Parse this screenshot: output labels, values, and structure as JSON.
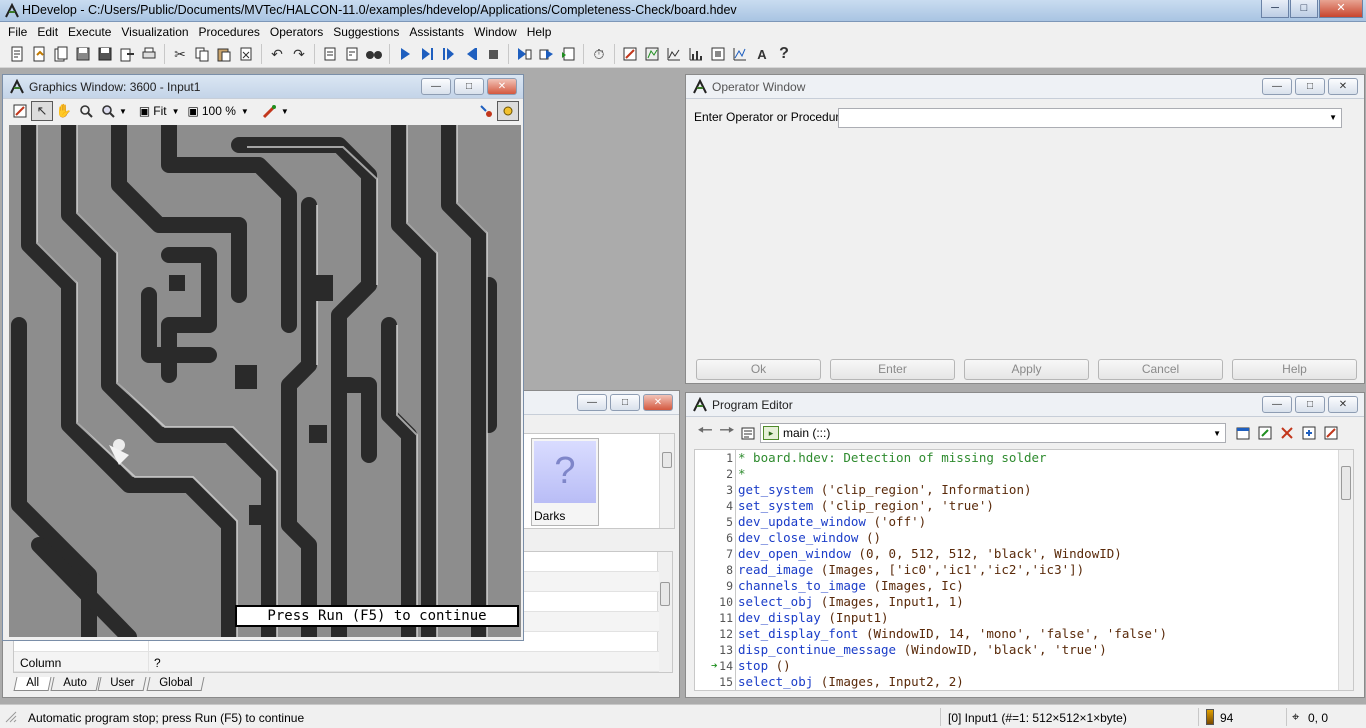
{
  "app": {
    "title": "HDevelop - C:/Users/Public/Documents/MVTec/HALCON-11.0/examples/hdevelop/Applications/Completeness-Check/board.hdev"
  },
  "menu": {
    "items": [
      {
        "label": "File",
        "key": "F"
      },
      {
        "label": "Edit",
        "key": "E"
      },
      {
        "label": "Execute",
        "key": "x"
      },
      {
        "label": "Visualization",
        "key": "V"
      },
      {
        "label": "Procedures",
        "key": "P"
      },
      {
        "label": "Operators",
        "key": "O"
      },
      {
        "label": "Suggestions",
        "key": "S"
      },
      {
        "label": "Assistants",
        "key": "A"
      },
      {
        "label": "Window",
        "key": "W"
      },
      {
        "label": "Help",
        "key": "H"
      }
    ]
  },
  "graphics_window": {
    "title": "Graphics Window: 3600 - Input1",
    "fit_label": "Fit",
    "zoom_label": "100 %",
    "continue_message": "Press Run (F5) to continue"
  },
  "operator_window": {
    "title": "Operator Window",
    "input_label": "Enter Operator or Procedure",
    "input_value": "",
    "buttons": [
      "Ok",
      "Enter",
      "Apply",
      "Cancel",
      "Help"
    ]
  },
  "variable_window": {
    "icon_tile_label": "Darks",
    "icon_tile_glyph": "?",
    "rows": [
      {
        "name": "",
        "value": ""
      },
      {
        "name": "",
        "value": ""
      },
      {
        "name": "",
        "value": ""
      },
      {
        "name": "",
        "value": ""
      },
      {
        "name": "",
        "value": ""
      },
      {
        "name": "Column",
        "value": "?"
      }
    ],
    "tabs": [
      "All",
      "Auto",
      "User",
      "Global"
    ],
    "active_tab": "All"
  },
  "program_editor": {
    "title": "Program Editor",
    "procedure": "main (:::)",
    "pc_line": 14,
    "lines": [
      {
        "n": "1",
        "kind": "comment",
        "text": "* board.hdev: Detection of missing solder"
      },
      {
        "n": "2",
        "kind": "comment",
        "text": "*"
      },
      {
        "n": "3",
        "kind": "op",
        "op": "get_system",
        "args": " ('clip_region', Information)"
      },
      {
        "n": "4",
        "kind": "op",
        "op": "set_system",
        "args": " ('clip_region', 'true')"
      },
      {
        "n": "5",
        "kind": "op",
        "op": "dev_update_window",
        "args": " ('off')"
      },
      {
        "n": "6",
        "kind": "op",
        "op": "dev_close_window",
        "args": " ()"
      },
      {
        "n": "7",
        "kind": "op",
        "op": "dev_open_window",
        "args": " (0, 0, 512, 512, 'black', WindowID)"
      },
      {
        "n": "8",
        "kind": "op",
        "op": "read_image",
        "args": " (Images, ['ic0','ic1','ic2','ic3'])"
      },
      {
        "n": "9",
        "kind": "op",
        "op": "channels_to_image",
        "args": " (Images, Ic)"
      },
      {
        "n": "10",
        "kind": "op",
        "op": "select_obj",
        "args": " (Images, Input1, 1)"
      },
      {
        "n": "11",
        "kind": "op",
        "op": "dev_display",
        "args": " (Input1)"
      },
      {
        "n": "12",
        "kind": "op",
        "op": "set_display_font",
        "args": " (WindowID, 14, 'mono', 'false', 'false')"
      },
      {
        "n": "13",
        "kind": "op",
        "op": "disp_continue_message",
        "args": " (WindowID, 'black', 'true')"
      },
      {
        "n": "14",
        "kind": "op",
        "op": "stop",
        "args": " ()"
      },
      {
        "n": "15",
        "kind": "op",
        "op": "select_obj",
        "args": " (Images, Input2, 2)"
      }
    ]
  },
  "status_bar": {
    "message": "Automatic program stop; press Run (F5) to continue",
    "image_info": "[0] Input1 (#=1: 512×512×1×byte)",
    "gray_value": "94",
    "coordinates": "0, 0"
  },
  "icons": {
    "app": "halcon-logo-icon",
    "new": "new-file-icon",
    "open": "open-file-icon",
    "save": "save-icon",
    "run": "run-icon",
    "stop": "stop-icon",
    "help": "help-icon"
  },
  "colors": {
    "op_blue": "#1a3cc8",
    "comment_green": "#2e8b2e",
    "title_bar": "#b9d1ea",
    "pc_arrow": "#1f8f1f"
  }
}
